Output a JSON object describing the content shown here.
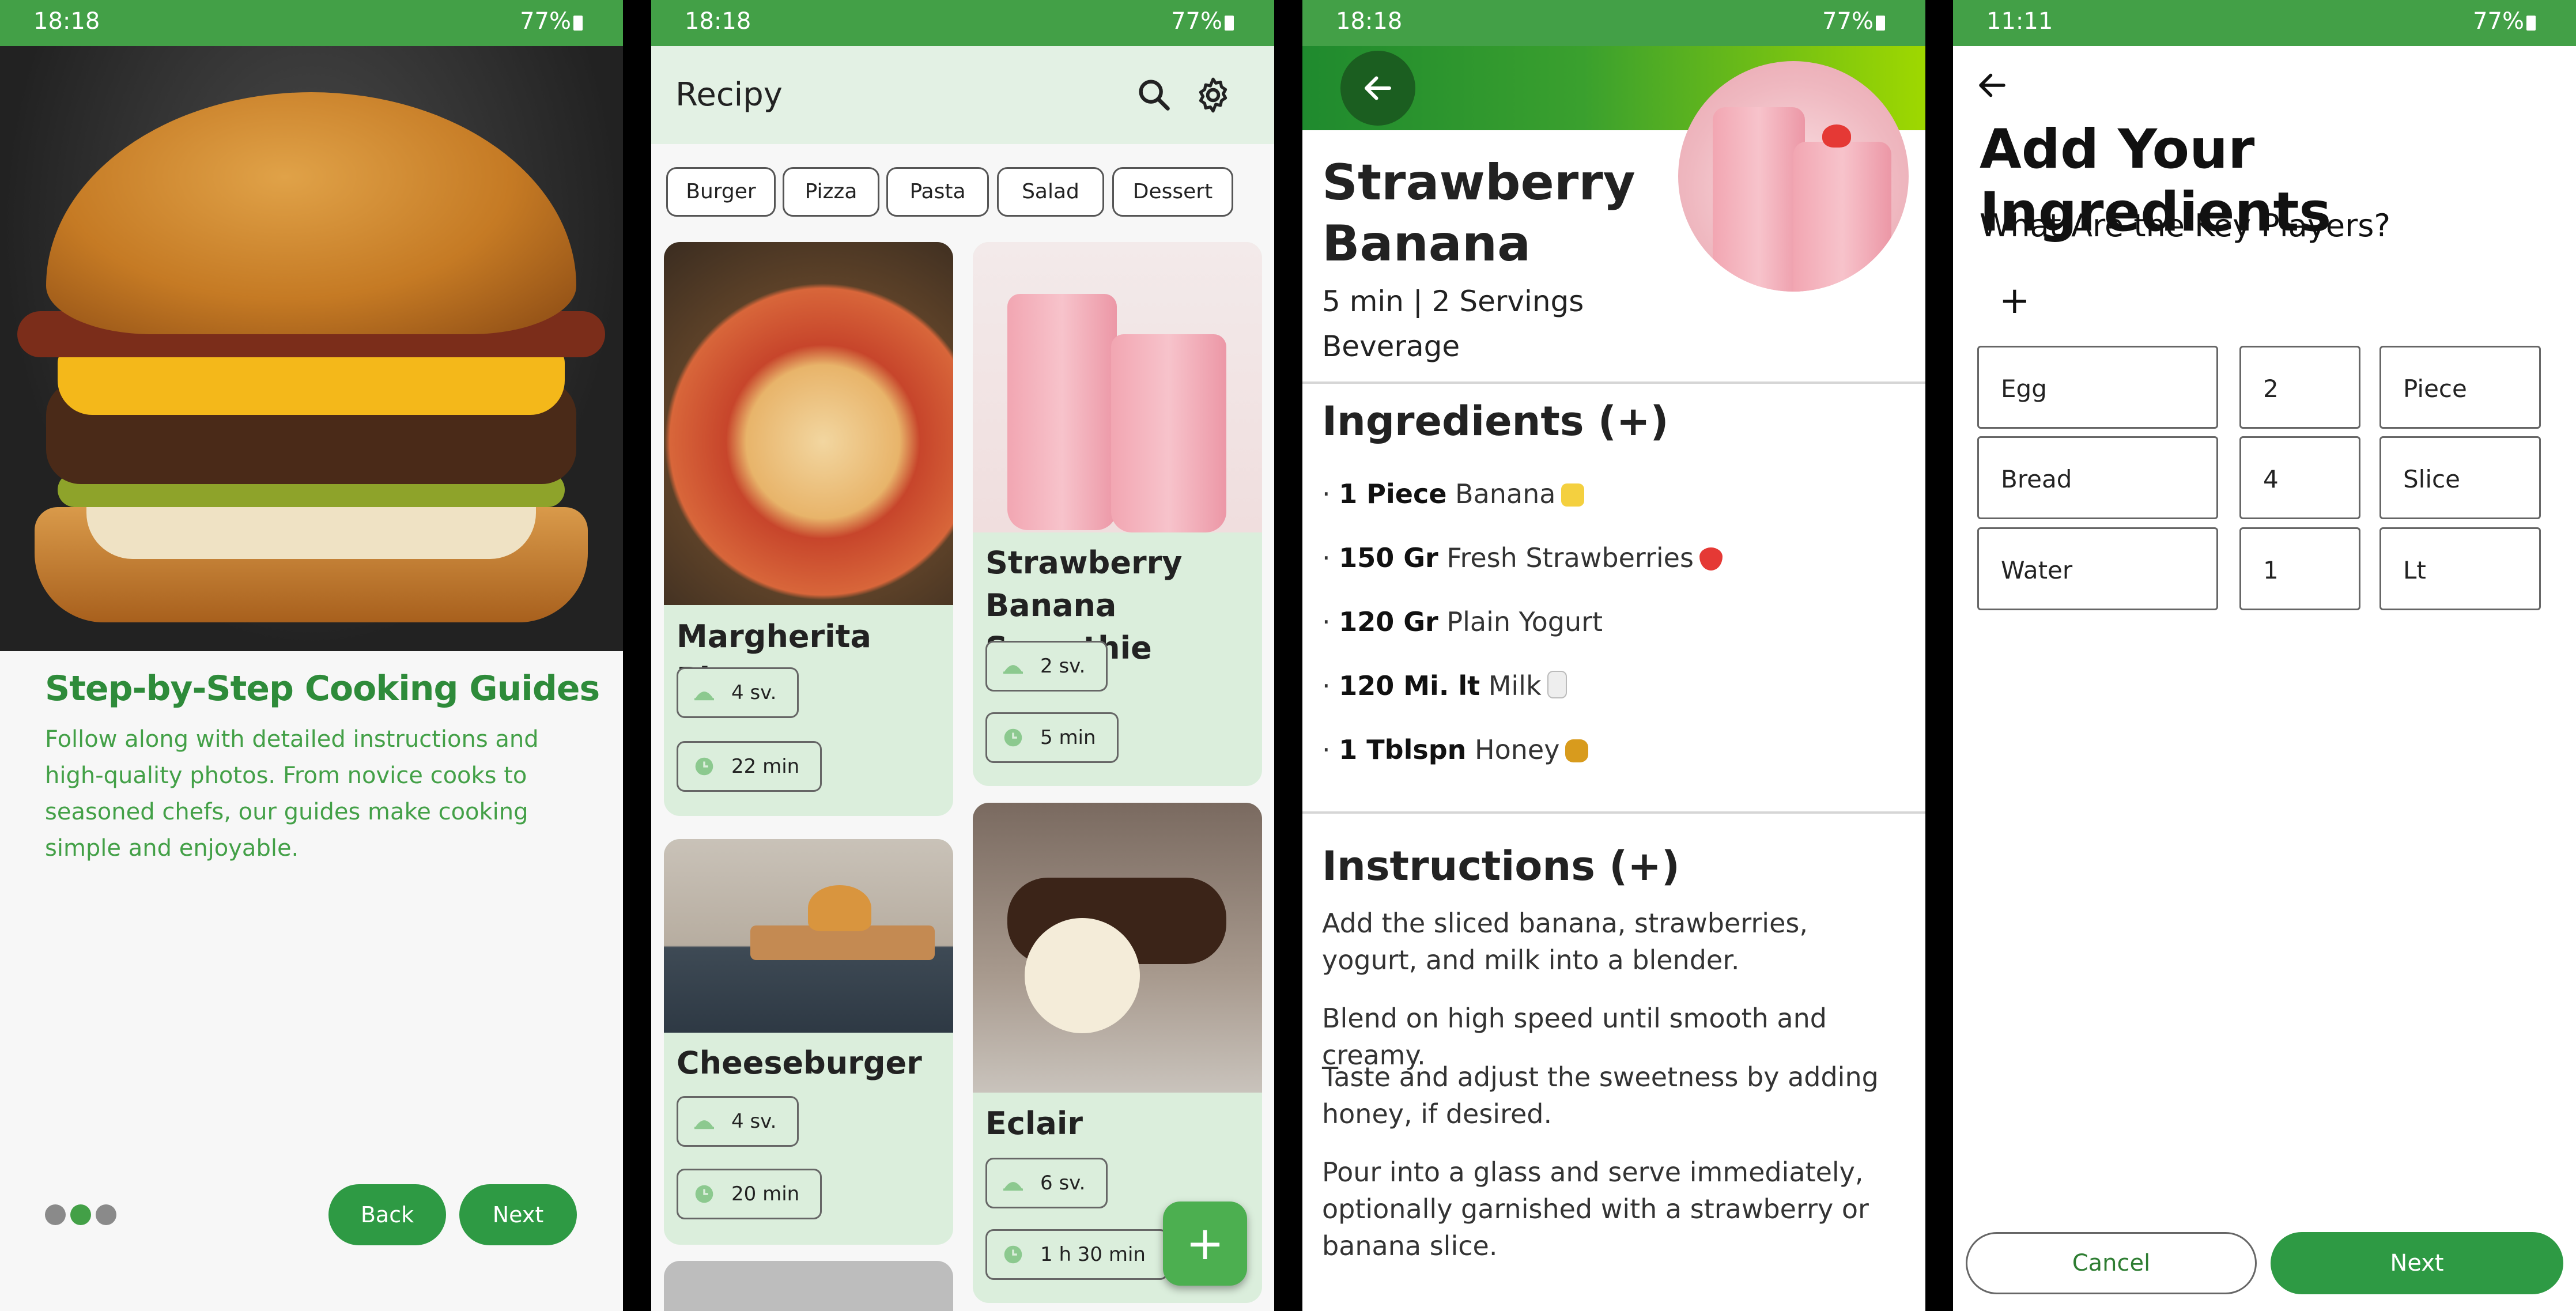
{
  "screen1": {
    "status": {
      "time": "18:18",
      "battery": "77%"
    },
    "title": "Step-by-Step Cooking Guides",
    "description": "Follow along with detailed instructions and high-quality photos. From novice cooks to seasoned chefs, our guides make cooking simple and enjoyable.",
    "page_dots": {
      "count": 3,
      "active": 1
    },
    "back_label": "Back",
    "next_label": "Next"
  },
  "screen2": {
    "status": {
      "time": "18:18",
      "battery": "77%"
    },
    "app_title": "Recipy",
    "chips": [
      "Burger",
      "Pizza",
      "Pasta",
      "Salad",
      "Dessert"
    ],
    "cards": [
      {
        "title": "Margherita Pizza",
        "servings": "4 sv.",
        "time": "22 min"
      },
      {
        "title": "Strawberry Banana Smoothie",
        "servings": "2 sv.",
        "time": "5 min"
      },
      {
        "title": "Cheeseburger",
        "servings": "4 sv.",
        "time": "20 min"
      },
      {
        "title": "Eclair",
        "servings": "6 sv.",
        "time": "1 h 30 min"
      }
    ],
    "fab_label": "+"
  },
  "screen3": {
    "status": {
      "time": "18:18",
      "battery": "77%"
    },
    "title": "Strawberry Banana",
    "meta": "5 min | 2 Servings",
    "category": "Beverage",
    "ingredients_heading": "Ingredients (+)",
    "ingredients": [
      {
        "qty": "1 Piece",
        "name": "Banana",
        "emoji_color": "#f4d03f"
      },
      {
        "qty": "150 Gr",
        "name": "Fresh Strawberries",
        "emoji_color": "#e53935"
      },
      {
        "qty": "120 Gr",
        "name": "Plain Yogurt",
        "emoji_color": ""
      },
      {
        "qty": "120 Mi. lt",
        "name": "Milk",
        "emoji_color": "#e6e6e6"
      },
      {
        "qty": "1 Tblspn",
        "name": "Honey",
        "emoji_color": "#d89b1d"
      }
    ],
    "instructions_heading": "Instructions (+)",
    "instructions": [
      "Add the sliced banana, strawberries, yogurt, and milk into a blender.",
      "Blend on high speed until smooth and creamy.",
      "Taste and adjust the sweetness by adding honey, if desired.",
      "Pour into a glass and serve immediately, optionally garnished with a strawberry or banana slice."
    ]
  },
  "screen4": {
    "status": {
      "time": "11:11",
      "battery": "77%"
    },
    "title": "Add Your Ingredients",
    "subtitle": "What Are the Key Players?",
    "add_label": "+",
    "rows": [
      {
        "name": "Egg",
        "amount": "2",
        "unit": "Piece"
      },
      {
        "name": "Bread",
        "amount": "4",
        "unit": "Slice"
      },
      {
        "name": "Water",
        "amount": "1",
        "unit": "Lt"
      }
    ],
    "cancel_label": "Cancel",
    "next_label": "Next"
  },
  "colors": {
    "primary": "#43a047",
    "primary_dark": "#2e9a44",
    "card_bg": "#dbeedc",
    "appbar_bg": "#e3f1e4"
  }
}
